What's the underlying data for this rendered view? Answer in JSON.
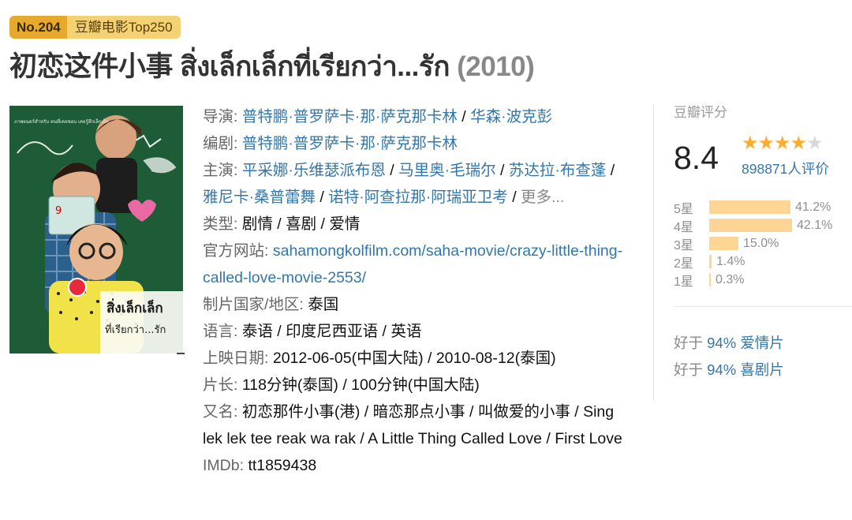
{
  "badge": {
    "rank": "No.204",
    "list": "豆瓣电影Top250"
  },
  "title": {
    "main": "初恋这件小事 สิ่งเล็กเล็กที่เรียกว่า...รัก",
    "year": "(2010)"
  },
  "poster": {
    "top_text": "ภาพยนตร์สำหรับ คนที่เคยชอบ เคยรู้สึกเล็กเล็ก",
    "title_line1": "สิ่งเล็กเล็ก",
    "title_line2": "ที่เรียกว่า...รัก",
    "badge_num": "9"
  },
  "info": {
    "director_label": "导演: ",
    "directors": [
      "普特鹏·普罗萨卡·那·萨克那卡林",
      "华森·波克彭"
    ],
    "writer_label": "编剧: ",
    "writers": [
      "普特鹏·普罗萨卡·那·萨克那卡林"
    ],
    "cast_label": "主演: ",
    "cast": [
      "平采娜·乐维瑟派布恩",
      "马里奥·毛瑞尔",
      "苏达拉·布查蓬",
      "雅尼卡·桑普蕾舞",
      "诺特·阿查拉那·阿瑞亚卫考"
    ],
    "more": "更多...",
    "genre_label": "类型: ",
    "genres": [
      "剧情",
      "喜剧",
      "爱情"
    ],
    "website_label": "官方网站: ",
    "website": "sahamongkolfilm.com/saha-movie/crazy-little-thing-called-love-movie-2553/",
    "country_label": "制片国家/地区: ",
    "country": "泰国",
    "language_label": "语言: ",
    "language": "泰语 / 印度尼西亚语 / 英语",
    "release_label": "上映日期: ",
    "release": "2012-06-05(中国大陆) / 2010-08-12(泰国)",
    "runtime_label": "片长: ",
    "runtime": "118分钟(泰国) / 100分钟(中国大陆)",
    "aka_label": "又名: ",
    "aka": "初恋那件小事(港) / 暗恋那点小事 / 叫做爱的小事 / Sing lek lek tee reak wa rak / A Little Thing Called Love / First Love",
    "imdb_label": "IMDb: ",
    "imdb": "tt1859438"
  },
  "rating": {
    "title": "豆瓣评分",
    "score": "8.4",
    "stars_filled": 4,
    "votes": "898871人评价",
    "distribution": [
      {
        "label": "5星",
        "percent": 41.2,
        "text": "41.2%"
      },
      {
        "label": "4星",
        "percent": 42.1,
        "text": "42.1%"
      },
      {
        "label": "3星",
        "percent": 15.0,
        "text": "15.0%"
      },
      {
        "label": "2星",
        "percent": 1.4,
        "text": "1.4%"
      },
      {
        "label": "1星",
        "percent": 0.3,
        "text": "0.3%"
      }
    ],
    "better_than": [
      {
        "prefix": "好于 ",
        "link": "94% 爱情片"
      },
      {
        "prefix": "好于 ",
        "link": "94% 喜剧片"
      }
    ]
  },
  "colors": {
    "link": "#3377aa",
    "star": "#ffac2d",
    "bar": "#ffd596",
    "badge_dark": "#e7a92b",
    "badge_light": "#f4d273"
  }
}
